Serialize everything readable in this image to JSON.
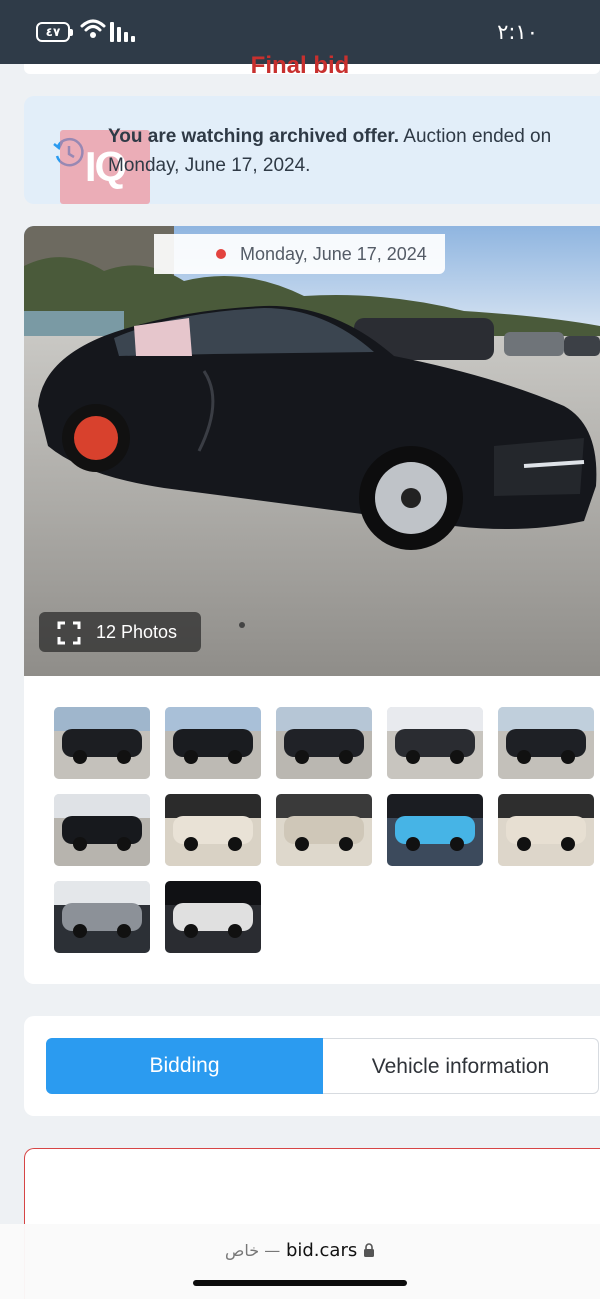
{
  "status_bar": {
    "time": "٢:١٠",
    "battery": "٤٧"
  },
  "notice": {
    "bold_text": "You are watching archived offer.",
    "text": " Auction ended on Monday, June 17, 2024.",
    "watermark": "IQ"
  },
  "gallery": {
    "date": "Monday, June 17, 2024",
    "photos_label": "12 Photos",
    "thumbnail_count": 12
  },
  "tabs": [
    {
      "label": "Bidding",
      "active": true
    },
    {
      "label": "Vehicle information",
      "active": false
    }
  ],
  "bid": {
    "title": "Final bid"
  },
  "browser": {
    "domain": "bid.cars",
    "private_label": "خاص —"
  },
  "colors": {
    "accent": "#2b9bf0",
    "alert_red": "#c8302e",
    "notice_bg": "#e2eef9"
  }
}
